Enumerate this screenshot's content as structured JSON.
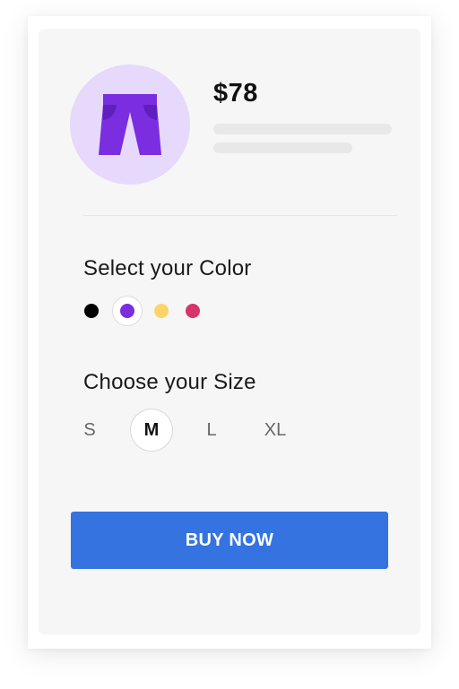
{
  "product": {
    "icon": "pants-icon",
    "price": "$78",
    "avatar_bg": "#e6d9fb",
    "icon_color": "#7a2ee0"
  },
  "color_section": {
    "title": "Select your Color",
    "options": [
      {
        "name": "black",
        "hex": "#000000",
        "selected": false
      },
      {
        "name": "purple",
        "hex": "#7a2ee0",
        "selected": true
      },
      {
        "name": "yellow",
        "hex": "#fbd46a",
        "selected": false
      },
      {
        "name": "pink",
        "hex": "#d6356a",
        "selected": false
      }
    ]
  },
  "size_section": {
    "title": "Choose your Size",
    "options": [
      {
        "label": "S",
        "selected": false
      },
      {
        "label": "M",
        "selected": true
      },
      {
        "label": "L",
        "selected": false
      },
      {
        "label": "XL",
        "selected": false
      }
    ]
  },
  "cta": {
    "label": "BUY NOW",
    "color": "#3473e0"
  }
}
